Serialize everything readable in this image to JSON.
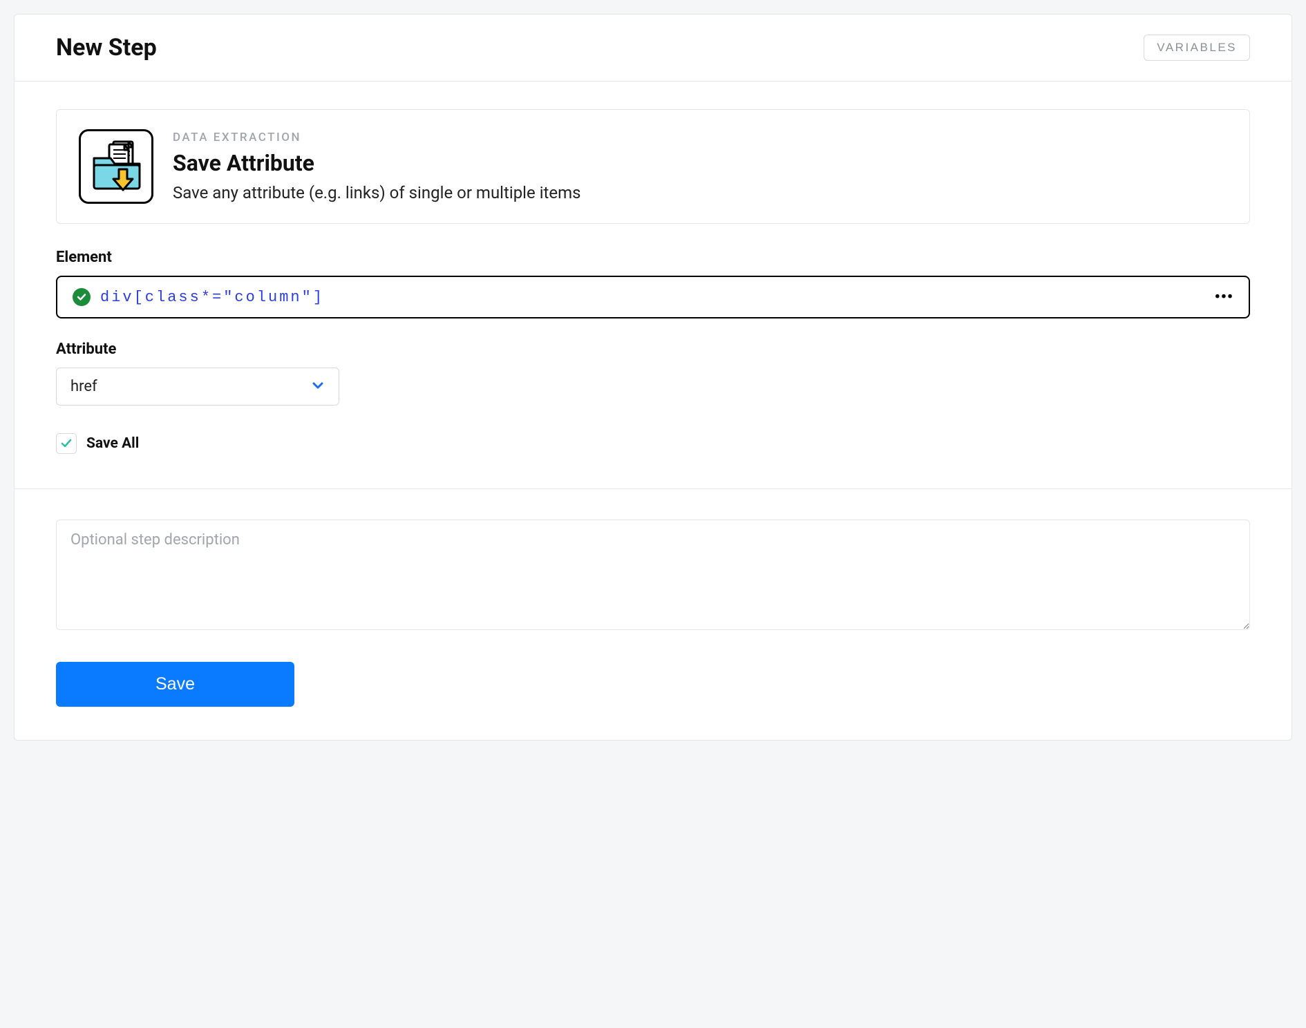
{
  "header": {
    "title": "New Step",
    "variables_button": "VARIABLES"
  },
  "step_card": {
    "category": "DATA EXTRACTION",
    "name": "Save Attribute",
    "description": "Save any attribute (e.g. links) of single or multiple items"
  },
  "element": {
    "label": "Element",
    "selector": "div[class*=\"column\"]",
    "status": "valid"
  },
  "attribute": {
    "label": "Attribute",
    "selected": "href"
  },
  "save_all": {
    "label": "Save All",
    "checked": true
  },
  "description": {
    "placeholder": "Optional step description",
    "value": ""
  },
  "actions": {
    "save": "Save"
  }
}
